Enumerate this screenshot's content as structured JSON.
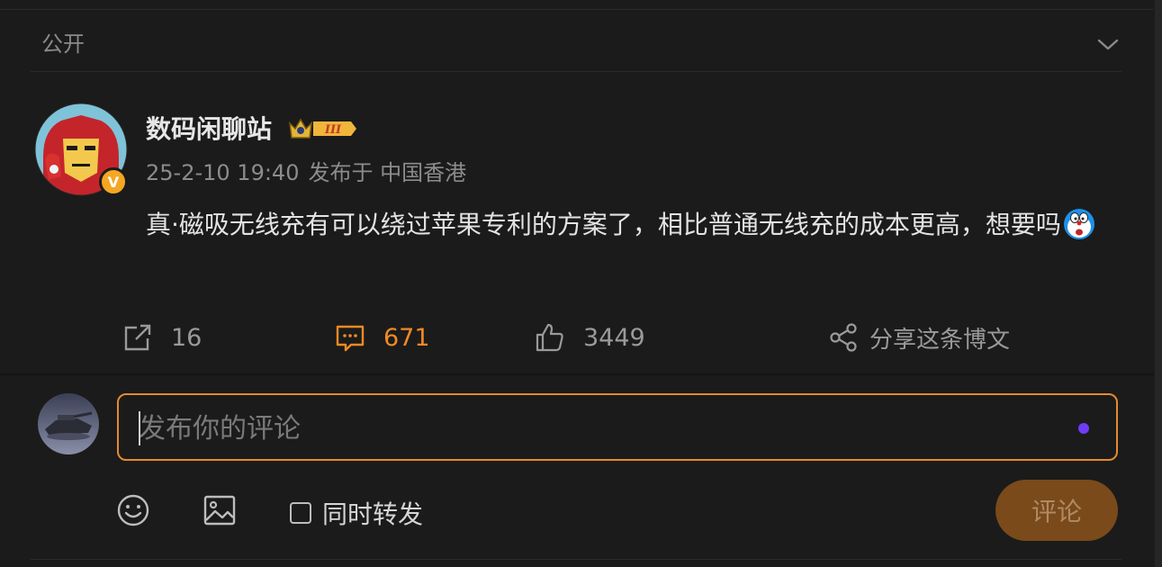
{
  "visibility": {
    "label": "公开"
  },
  "post": {
    "user_name": "数码闲聊站",
    "badge_text": "III",
    "time": "25-2-10 19:40",
    "source": "发布于 中国香港",
    "text": "真·磁吸无线充有可以绕过苹果专利的方案了，相比普通无线充的成本更高，想要吗",
    "emoji": "doraemon-emoji",
    "verified_mark": "V"
  },
  "actions": {
    "repost_count": "16",
    "comment_count": "671",
    "like_count": "3449",
    "share_label": "分享这条博文"
  },
  "composer": {
    "placeholder": "发布你的评论",
    "sync_label": "同时转发",
    "submit_label": "评论"
  },
  "colors": {
    "accent": "#f08a25",
    "background": "#1b1b1b",
    "submit_bg": "#7a4a1b",
    "indicator_dot": "#6f3cf5"
  },
  "icons": [
    "chevron-down-icon",
    "repost-icon",
    "comment-icon",
    "like-icon",
    "share-icon",
    "emoji-icon",
    "image-icon"
  ]
}
